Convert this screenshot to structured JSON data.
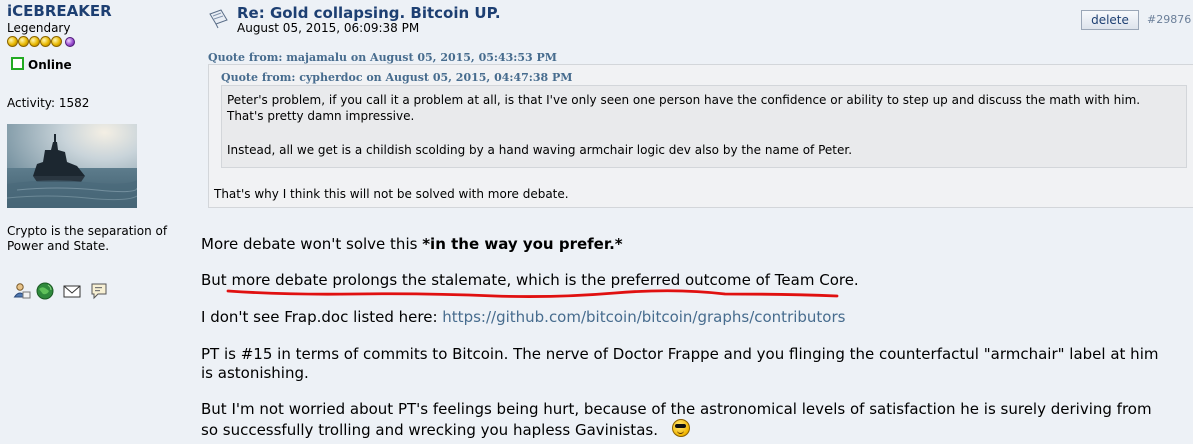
{
  "author": {
    "username": "iCEBREAKER",
    "rank": "Legendary",
    "star_count": 5,
    "status": "Online",
    "activity": "Activity: 1582",
    "signature": "Crypto is the separation of Power and State.",
    "profile_icons": [
      "profile-icon",
      "website-globe-icon",
      "email-icon",
      "personal-message-icon"
    ]
  },
  "post": {
    "title": "Re: Gold collapsing. Bitcoin UP.",
    "date": "August 05, 2015, 06:09:38 PM",
    "delete_label": "delete",
    "post_number": "#29876"
  },
  "quote_outer": {
    "header": "Quote from: majamalu on August 05, 2015, 05:43:53 PM",
    "text": "That's why I think this will not be solved with more debate."
  },
  "quote_inner": {
    "header": "Quote from: cypherdoc on August 05, 2015, 04:47:38 PM",
    "line1": "Peter's problem, if you call it a problem at all, is that I've only seen one person have the confidence or ability to step up and discuss the math with him.",
    "line2": "That's pretty damn  impressive.",
    "line3": "Instead, all we get is a childish scolding by a hand waving armchair logic dev also by the name of Peter."
  },
  "body": {
    "p1_plain": "More debate won't solve this ",
    "p1_bold": "*in the way you prefer.*",
    "p2": "But more debate prolongs the stalemate, which is the preferred outcome of Team Core.",
    "p3_plain": "I don't see Frap.doc listed here: ",
    "p3_link": "https://github.com/bitcoin/bitcoin/graphs/contributors",
    "p4": "PT is #15 in terms of commits to Bitcoin.  The nerve of Doctor Frappe and you flinging the counterfactul \"armchair\" label at him is astonishing.",
    "p5": "But I'm not worried about PT's feelings being hurt, because of the astronomical levels of satisfaction he is surely deriving from so successfully trolling and wrecking you hapless Gavinistas.",
    "smiley": "cool-sunglasses-smiley"
  },
  "colors": {
    "page_bg": "#edf1f6",
    "link_blue": "#1d3f72",
    "quote_header": "#476c8e",
    "annotation_red": "#e01010"
  }
}
